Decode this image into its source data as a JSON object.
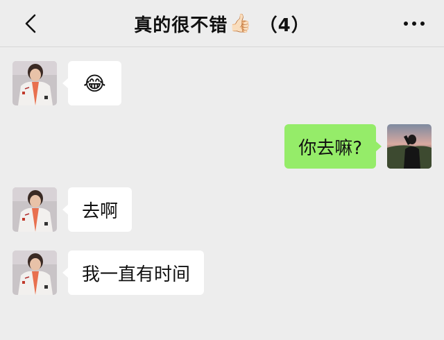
{
  "header": {
    "title_text": "真的很不错",
    "title_emoji": "👍🏻",
    "title_count": "（4）"
  },
  "messages": [
    {
      "side": "left",
      "content": "😂",
      "avatar": "boy-avatar-icon"
    },
    {
      "side": "right",
      "content": "你去嘛?",
      "avatar": "girl-avatar-icon"
    },
    {
      "side": "left",
      "content": "去啊",
      "avatar": "boy-avatar-icon"
    },
    {
      "side": "left",
      "content": "我一直有时间",
      "avatar": "boy-avatar-icon"
    }
  ],
  "colors": {
    "background": "#ededed",
    "incoming_bubble": "#ffffff",
    "outgoing_bubble": "#95ec69"
  }
}
